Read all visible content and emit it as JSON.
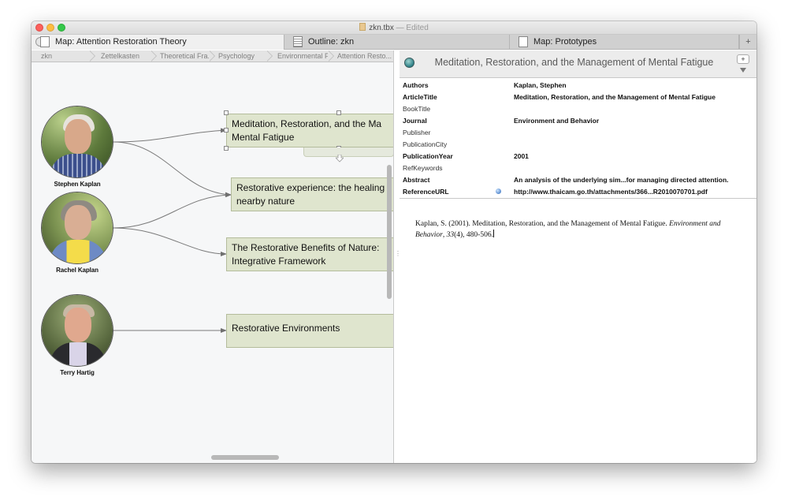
{
  "window": {
    "title": "zkn.tbx",
    "edited": "— Edited"
  },
  "tabs": [
    {
      "label": "Map: Attention Restoration Theory"
    },
    {
      "label": "Outline: zkn"
    },
    {
      "label": "Map: Prototypes"
    }
  ],
  "tab_add": "+",
  "breadcrumbs": [
    "zkn",
    "Zettelkasten",
    "Theoretical Fra...",
    "Psychology",
    "Environmental P...",
    "Attention Resto..."
  ],
  "people": [
    {
      "name": "Stephen Kaplan"
    },
    {
      "name": "Rachel Kaplan"
    },
    {
      "name": "Terry Hartig"
    }
  ],
  "notes": [
    {
      "line1": "Meditation, Restoration, and the Ma",
      "line2": "Mental Fatigue"
    },
    {
      "line1": "Restorative experience: the healing",
      "line2": "nearby nature"
    },
    {
      "line1": "The Restorative Benefits of Nature:",
      "line2": "Integrative Framework"
    },
    {
      "line1": "Restorative Environments",
      "line2": ""
    }
  ],
  "detail": {
    "title": "Meditation, Restoration, and the Management of Mental Fatigue",
    "add_button": "+",
    "attributes": [
      {
        "key": "Authors",
        "value": "Kaplan, Stephen",
        "bold": true
      },
      {
        "key": "ArticleTitle",
        "value": "Meditation, Restoration, and the Management of Mental Fatigue",
        "bold": true
      },
      {
        "key": "BookTitle",
        "value": "",
        "bold": false
      },
      {
        "key": "Journal",
        "value": "Environment and Behavior",
        "bold": true
      },
      {
        "key": "Publisher",
        "value": "",
        "bold": false
      },
      {
        "key": "PublicationCity",
        "value": "",
        "bold": false
      },
      {
        "key": "PublicationYear",
        "value": "2001",
        "bold": true
      },
      {
        "key": "RefKeywords",
        "value": "",
        "bold": false
      },
      {
        "key": "Abstract",
        "value": "An analysis of the underlying sim...for managing directed attention.",
        "bold": true
      },
      {
        "key": "ReferenceURL",
        "value": "http://www.thaicam.go.th/attachments/366...R2010070701.pdf",
        "bold": true
      }
    ],
    "citation": {
      "pre": "Kaplan, S. (2001). Meditation, Restoration, and the Management of Mental Fatigue. ",
      "journal": "Environment and Behavior",
      "comma": ",",
      "volume": "33",
      "rest": "(4), 480-506."
    }
  }
}
